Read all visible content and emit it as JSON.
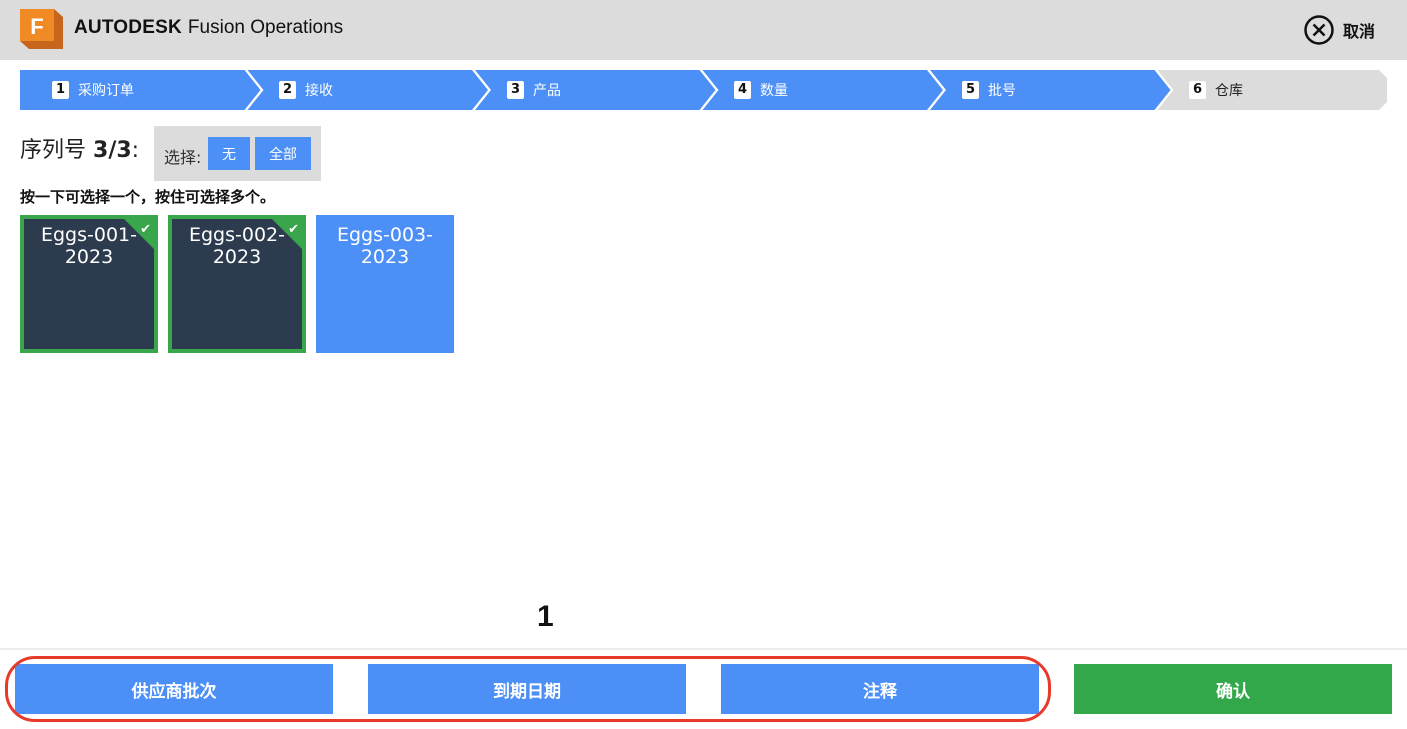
{
  "header": {
    "logo_letter": "F",
    "brand_bold": "AUTODESK",
    "brand_rest": "Fusion Operations",
    "cancel_label": "取消",
    "logo_color": "#f08a24"
  },
  "stepper": {
    "steps": [
      {
        "num": "1",
        "label": "采购订单",
        "state": "done"
      },
      {
        "num": "2",
        "label": "接收",
        "state": "done"
      },
      {
        "num": "3",
        "label": "产品",
        "state": "done"
      },
      {
        "num": "4",
        "label": "数量",
        "state": "done"
      },
      {
        "num": "5",
        "label": "批号",
        "state": "done"
      },
      {
        "num": "6",
        "label": "仓库",
        "state": "todo"
      }
    ],
    "done_color": "#4b8ff7",
    "todo_color": "#dcdcdc"
  },
  "serial": {
    "title": "序列号",
    "count": "3/3",
    "colon": ":",
    "select_label": "选择:",
    "none_label": "无",
    "all_label": "全部",
    "hint": "按一下可选择一个，按住可选择多个。"
  },
  "tiles": [
    {
      "line1": "Eggs-001-",
      "line2": "2023",
      "selected": true
    },
    {
      "line1": "Eggs-002-",
      "line2": "2023",
      "selected": true
    },
    {
      "line1": "Eggs-003-",
      "line2": "2023",
      "selected": false
    }
  ],
  "annotation_number": "1",
  "footer": {
    "supplier_batch": "供应商批次",
    "expiry_date": "到期日期",
    "notes": "注释",
    "confirm": "确认"
  },
  "colors": {
    "accent_blue": "#4b8ff7",
    "confirm_green": "#33a84a",
    "selected_tile": "#2d3b4e",
    "highlight_red": "#e83a2a"
  }
}
